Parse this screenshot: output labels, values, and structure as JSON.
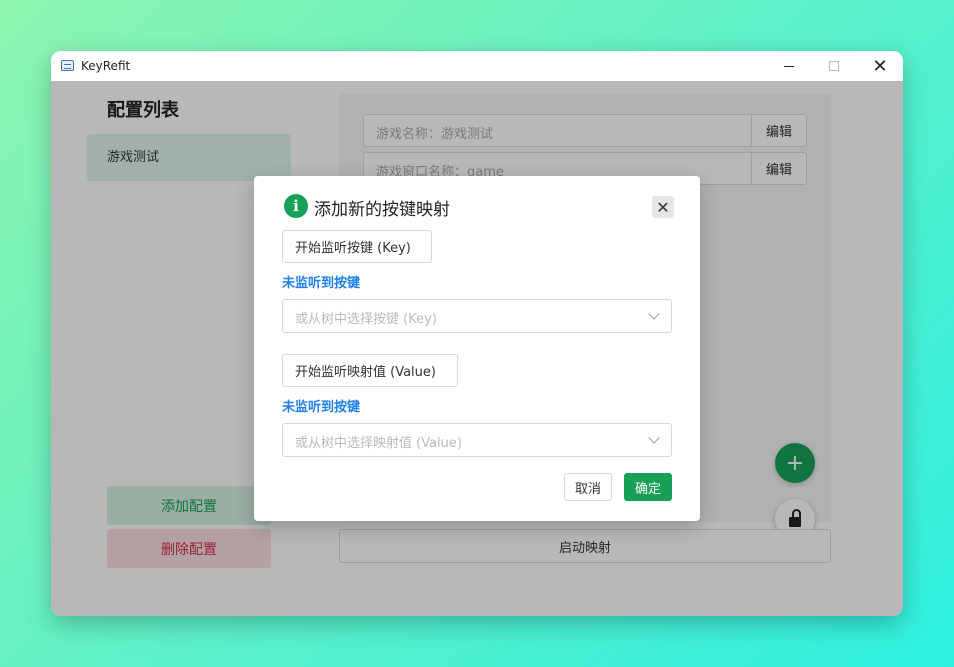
{
  "window": {
    "title": "KeyRefit",
    "app_icon": "keyboard-icon",
    "minimize_icon": "minimize-icon",
    "maximize_icon": "maximize-icon",
    "close_glyph": "✕"
  },
  "sidebar": {
    "title": "配置列表",
    "configs": [
      {
        "label": "游戏测试"
      }
    ],
    "add_label": "添加配置",
    "delete_label": "删除配置"
  },
  "main": {
    "game_name_text": "游戏名称：游戏测试",
    "window_name_text": "游戏窗口名称：game",
    "edit_label": "编辑",
    "add_glyph": "+",
    "lock_icon": "unlock-icon",
    "start_label": "启动映射"
  },
  "dialog": {
    "title": "添加新的按键映射",
    "icon": "info-icon",
    "icon_glyph": "i",
    "close_glyph": "✕",
    "listen_key_label": "开始监听按键 (Key)",
    "key_status": "未监听到按键",
    "key_placeholder": "或从树中选择按键 (Key)",
    "listen_value_label": "开始监听映射值 (Value)",
    "value_status": "未监听到按键",
    "value_placeholder": "或从树中选择映射值 (Value)",
    "cancel_label": "取消",
    "ok_label": "确定"
  },
  "colors": {
    "primary": "#18a058",
    "danger": "#d03050",
    "info": "#2080f0"
  }
}
